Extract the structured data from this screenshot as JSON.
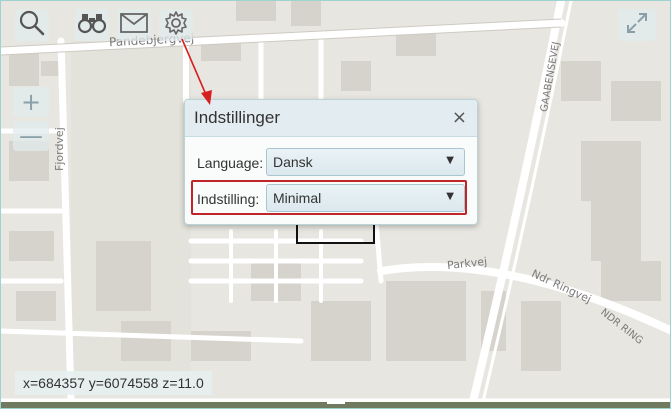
{
  "toolbar": {
    "search_icon": "search-icon",
    "binoculars_icon": "binoculars-icon",
    "mail_icon": "envelope-icon",
    "settings_icon": "gear-icon"
  },
  "map": {
    "streets": {
      "pandebjergvej": "Pandebjergvej",
      "fjordvej": "Fjordvej",
      "gaabensevej": "GAABENSEVEJ",
      "parkvej": "Parkvej",
      "ndr_ringvej": "Ndr Ringvej",
      "ndr_ring_caps": "NDR RING"
    },
    "zoom_in": "+",
    "zoom_out": "—",
    "fullscreen_icon": "expand-icon"
  },
  "coords": {
    "text": "x=684357 y=6074558 z=11.0"
  },
  "settings_dialog": {
    "title": "Indstillinger",
    "close": "×",
    "language_label": "Language:",
    "language_value": "Dansk",
    "setting_label": "Indstilling:",
    "setting_value": "Minimal",
    "caret": "▼"
  },
  "colors": {
    "highlight": "#c0252a",
    "arrow": "#d62020",
    "map_bg": "#e8e6e0",
    "building": "#d6d2cc",
    "road": "#ffffff"
  }
}
